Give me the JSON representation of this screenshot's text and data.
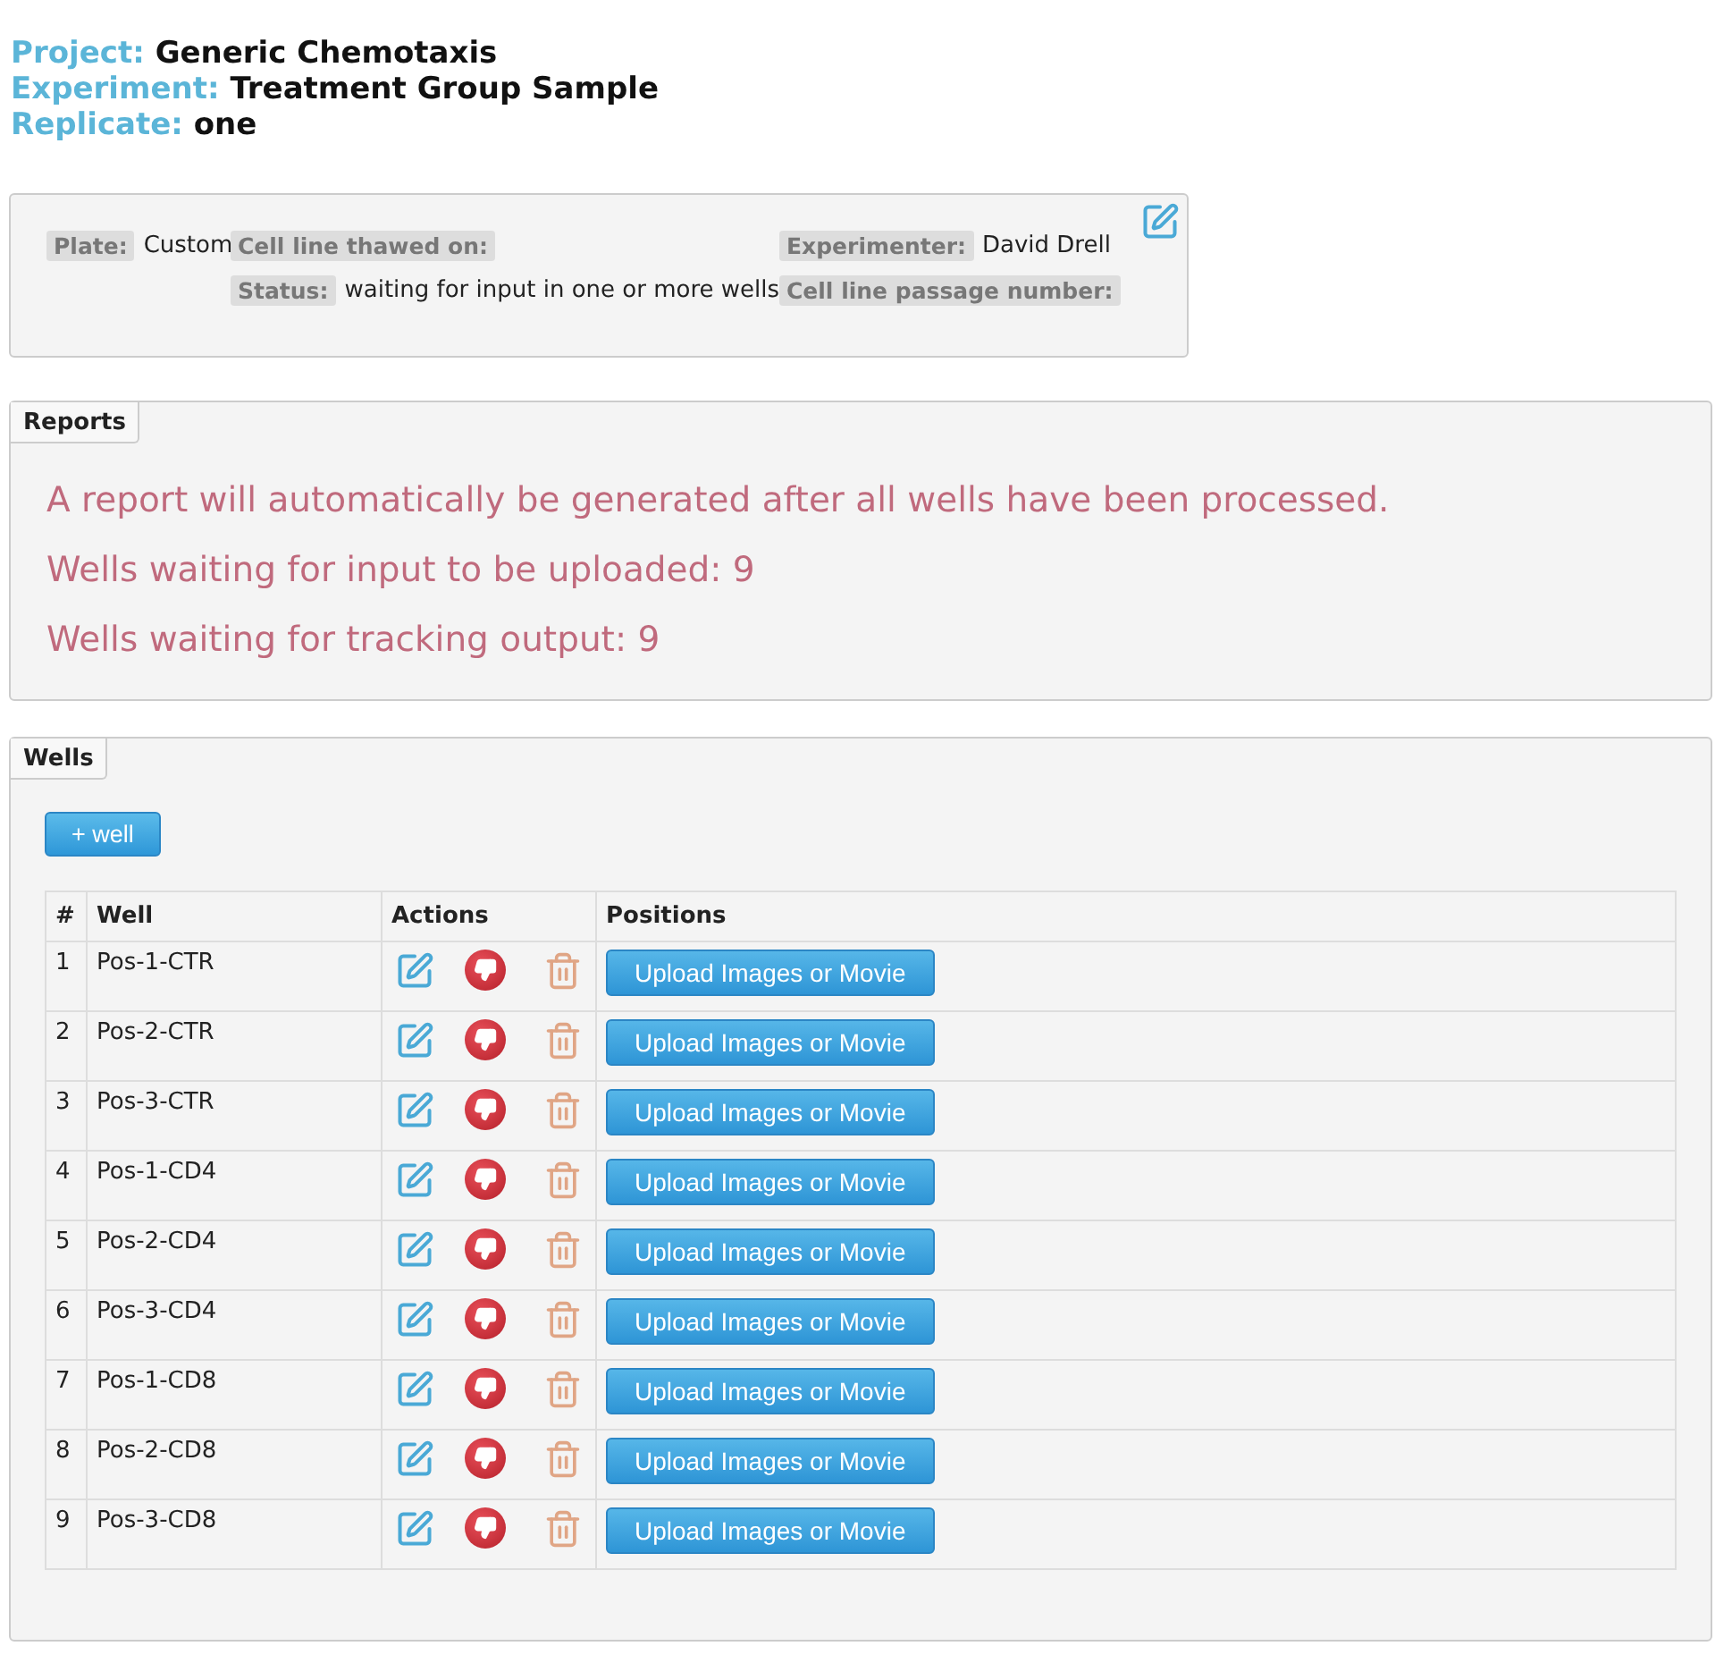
{
  "header": [
    {
      "label": "Project:",
      "value": "Generic Chemotaxis"
    },
    {
      "label": "Experiment:",
      "value": "Treatment Group Sample"
    },
    {
      "label": "Replicate:",
      "value": "one"
    }
  ],
  "info": {
    "rows": [
      [
        {
          "label": "Plate:",
          "value": "Custom"
        },
        {
          "label": "Cell line thawed on:"
        },
        {
          "label": "Experimenter:",
          "value": "David Drell"
        }
      ],
      [
        "",
        {
          "label": "Status:",
          "value": "waiting for input in one or more wells"
        },
        {
          "label": "Cell line passage number:"
        }
      ]
    ]
  },
  "reports": {
    "title": "Reports",
    "messages": [
      "A report will automatically be generated after all wells have been processed.",
      "Wells waiting for input to be uploaded: 9",
      "Wells waiting for tracking output: 9"
    ]
  },
  "wells": {
    "title": "Wells",
    "add_button": "+ well",
    "columns": [
      "#",
      "Well",
      "Actions",
      "Positions"
    ],
    "rows": [
      {
        "number": "1",
        "well": "Pos-1-CTR",
        "upload": "Upload Images or Movie"
      },
      {
        "number": "2",
        "well": "Pos-2-CTR",
        "upload": "Upload Images or Movie"
      },
      {
        "number": "3",
        "well": "Pos-3-CTR",
        "upload": "Upload Images or Movie"
      },
      {
        "number": "4",
        "well": "Pos-1-CD4",
        "upload": "Upload Images or Movie"
      },
      {
        "number": "5",
        "well": "Pos-2-CD4",
        "upload": "Upload Images or Movie"
      },
      {
        "number": "6",
        "well": "Pos-3-CD4",
        "upload": "Upload Images or Movie"
      },
      {
        "number": "7",
        "well": "Pos-1-CD8",
        "upload": "Upload Images or Movie"
      },
      {
        "number": "8",
        "well": "Pos-2-CD8",
        "upload": "Upload Images or Movie"
      },
      {
        "number": "9",
        "well": "Pos-3-CD8",
        "upload": "Upload Images or Movie"
      }
    ]
  }
}
